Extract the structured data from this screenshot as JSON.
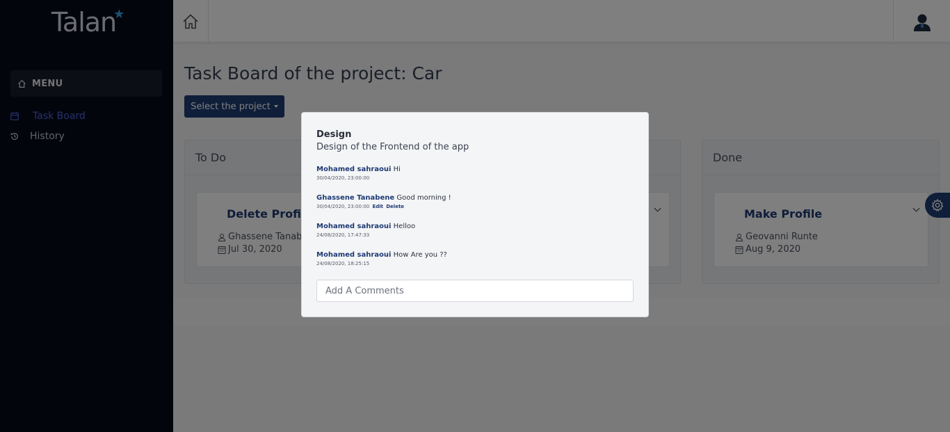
{
  "app": {
    "logo_text": "Talan"
  },
  "sidebar": {
    "menu_label": "MENU",
    "items": [
      {
        "label": "Task Board",
        "icon": "calendar-icon",
        "active": true
      },
      {
        "label": "History",
        "icon": "history-icon",
        "active": false
      }
    ]
  },
  "header": {
    "home_icon": "home-icon",
    "avatar_icon": "user-avatar-icon"
  },
  "main": {
    "title": "Task Board of the project: Car",
    "select_project_label": "Select the project",
    "columns": [
      {
        "title": "To Do",
        "cards": [
          {
            "title": "Delete Profil",
            "assignee": "Ghassene Tanab",
            "date": "Jul 30, 2020"
          }
        ]
      },
      {
        "title": "",
        "cards": [
          {
            "title": "",
            "assignee": "",
            "date": ""
          }
        ]
      },
      {
        "title": "Done",
        "cards": [
          {
            "title": "Make Profile",
            "assignee": "Geovanni Runte",
            "date": "Aug 9, 2020"
          }
        ]
      }
    ]
  },
  "modal": {
    "title": "Design",
    "description": "Design of the Frontend of the app",
    "comments": [
      {
        "author": "Mohamed sahraoui",
        "text": "Hi",
        "time": "30/04/2020, 23:00:00",
        "actions": []
      },
      {
        "author": "Ghassene Tanabene",
        "text": "Good morning !",
        "time": "30/04/2020, 23:00:00",
        "actions": [
          "Edit",
          "Delete"
        ]
      },
      {
        "author": "Mohamed sahraoui",
        "text": "Helloo",
        "time": "24/08/2020, 17:47:33",
        "actions": []
      },
      {
        "author": "Mohamed sahraoui",
        "text": "How Are you ??",
        "time": "24/08/2020, 18:25:15",
        "actions": []
      }
    ],
    "comment_placeholder": "Add A Comments"
  },
  "colors": {
    "sidebar_bg": "#070b1a",
    "primary": "#1f3d73",
    "active_nav": "#4e64d8"
  }
}
